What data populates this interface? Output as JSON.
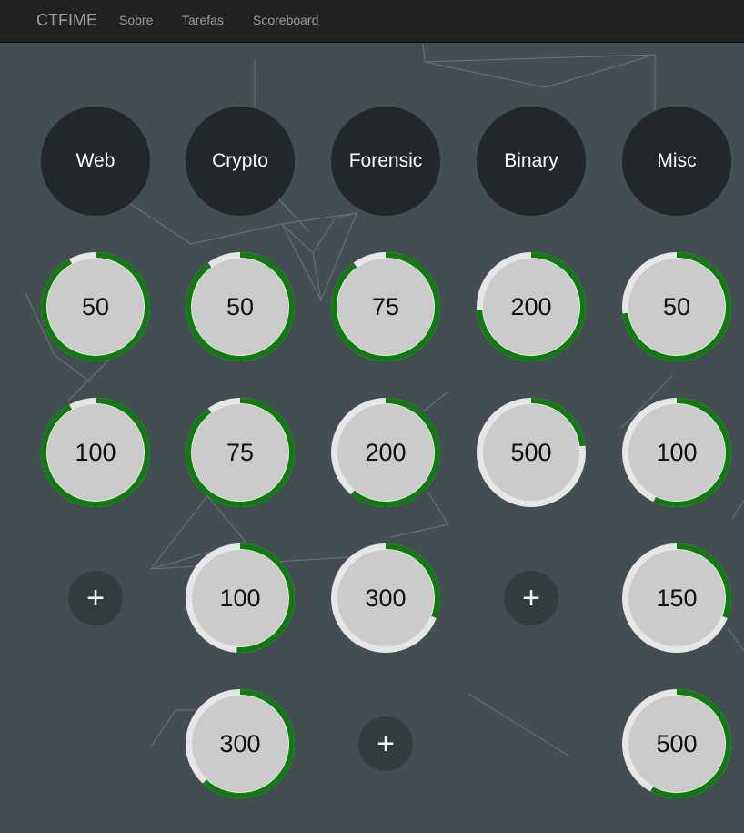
{
  "navbar": {
    "brand": "CTFIME",
    "links": [
      "Sobre",
      "Tarefas",
      "Scoreboard"
    ]
  },
  "colors": {
    "background": "#434e52",
    "navbar": "#222222",
    "category": "#22272a",
    "progress": "#0f7b0f",
    "track": "#e6e6e6",
    "task_inner": "#cbcbcb"
  },
  "add_label": "+",
  "categories": [
    {
      "name": "Web",
      "tasks": [
        {
          "points": "50",
          "progress": 0.92
        },
        {
          "points": "100",
          "progress": 0.92
        }
      ],
      "add_row": 2
    },
    {
      "name": "Crypto",
      "tasks": [
        {
          "points": "50",
          "progress": 0.9
        },
        {
          "points": "75",
          "progress": 0.9
        },
        {
          "points": "100",
          "progress": 0.51
        },
        {
          "points": "300",
          "progress": 0.62
        }
      ],
      "add_row": null
    },
    {
      "name": "Forensic",
      "tasks": [
        {
          "points": "75",
          "progress": 0.9
        },
        {
          "points": "200",
          "progress": 0.61
        },
        {
          "points": "300",
          "progress": 0.31
        }
      ],
      "add_row": 3
    },
    {
      "name": "Binary",
      "tasks": [
        {
          "points": "200",
          "progress": 0.74
        },
        {
          "points": "500",
          "progress": 0.23
        }
      ],
      "add_row": 2
    },
    {
      "name": "Misc",
      "tasks": [
        {
          "points": "50",
          "progress": 0.73
        },
        {
          "points": "100",
          "progress": 0.57
        },
        {
          "points": "150",
          "progress": 0.31
        },
        {
          "points": "500",
          "progress": 0.58
        }
      ],
      "add_row": null
    }
  ]
}
